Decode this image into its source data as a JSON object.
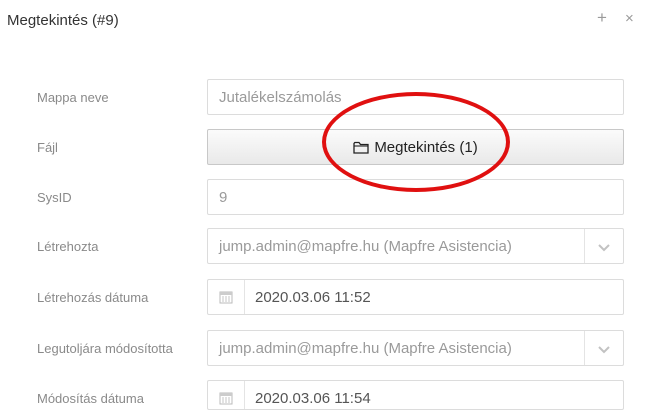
{
  "window": {
    "title": "Megtekintés (#9)",
    "plus_symbol": "+",
    "close_symbol": "×"
  },
  "form": {
    "folder_name": {
      "label": "Mappa neve",
      "value": "Jutalékelszámolás"
    },
    "file": {
      "label": "Fájl",
      "button_label": "Megtekintés (1)",
      "icon": "folder-icon"
    },
    "sysid": {
      "label": "SysID",
      "value": "9"
    },
    "created_by": {
      "label": "Létrehozta",
      "value": "jump.admin@mapfre.hu (Mapfre Asistencia)"
    },
    "created_date": {
      "label": "Létrehozás dátuma",
      "value": "2020.03.06 11:52"
    },
    "modified_by": {
      "label": "Legutoljára módosította",
      "value": "jump.admin@mapfre.hu (Mapfre Asistencia)"
    },
    "modified_date": {
      "label": "Módosítás dátuma",
      "value": "2020.03.06 11:54"
    }
  },
  "annotation": {
    "color": "#e01010"
  }
}
